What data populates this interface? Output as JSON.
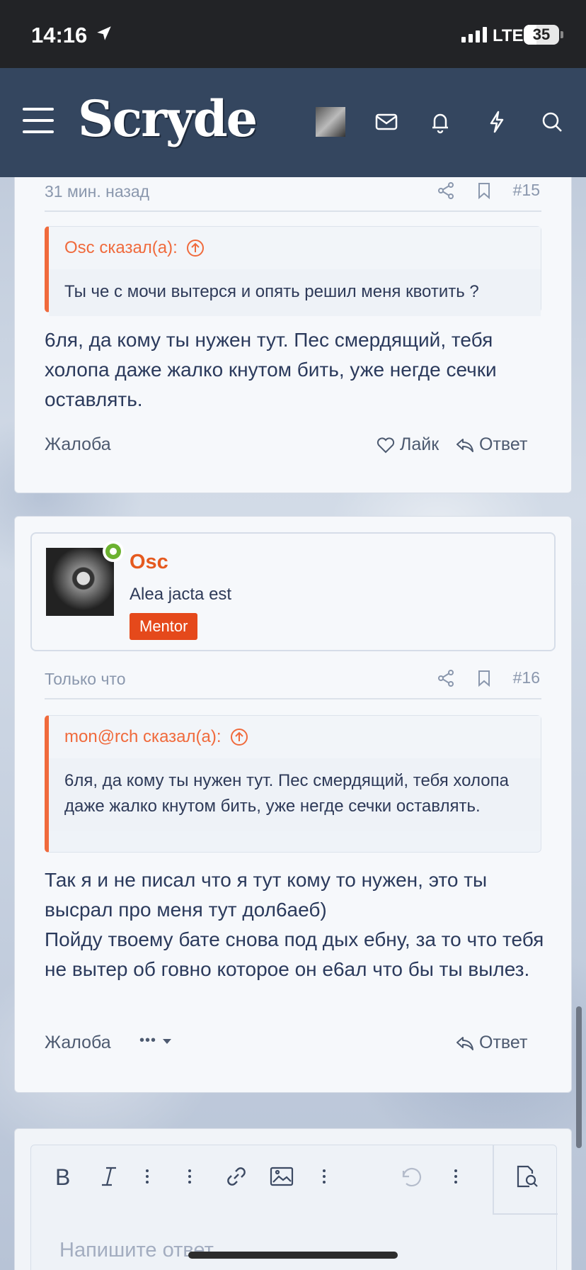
{
  "status_bar": {
    "time": "14:16",
    "network": "LTE",
    "battery": "35",
    "battery_fraction": 0.35
  },
  "header": {
    "logo": "Scryde",
    "icons": [
      "menu-icon",
      "avatar",
      "mail-icon",
      "bell-icon",
      "bolt-icon",
      "search-icon"
    ]
  },
  "posts": [
    {
      "time": "31 мин. назад",
      "number": "#15",
      "quote": {
        "author": "Osc сказал(а):",
        "text": "Ты че с мочи вытерся и опять решил меня квотить ?"
      },
      "text": "6ля, да кому ты нужен тут. Пес смердящий, тебя холопа даже жалко кнутом бить, уже негде сечки оставлять.",
      "actions": {
        "report": "Жалоба",
        "like": "Лайк",
        "reply": "Ответ"
      }
    },
    {
      "user": {
        "name": "Osc",
        "title": "Alea jacta est",
        "badge": "Mentor",
        "online": true
      },
      "time": "Только что",
      "number": "#16",
      "quote": {
        "author": "mon@rch сказал(а):",
        "text": "6ля, да кому ты нужен тут. Пес смердящий, тебя холопа даже жалко кнутом бить, уже негде сечки оставлять."
      },
      "text_lines": [
        "Так я и не писал что я тут кому то нужен, это ты высрал про меня тут дол6аеб)",
        "Пойду твоему бате снова под дых ебну, за то что тебя не вытер об говно которое он е6ал что бы ты вылез."
      ],
      "actions": {
        "report": "Жалоба",
        "more": "•••",
        "reply": "Ответ"
      }
    }
  ],
  "editor": {
    "placeholder": "Напишите ответ...",
    "toolbar": [
      "bold-icon",
      "italic-icon",
      "more-vertical-icon",
      "more-vertical-icon",
      "link-icon",
      "image-icon",
      "more-vertical-icon",
      "undo-icon",
      "more-vertical-icon",
      "preview-icon"
    ]
  },
  "colors": {
    "header_bg": "#34465f",
    "accent": "#f06a3c",
    "username": "#e55a1f",
    "badge": "#e5491b",
    "online": "#6cb230"
  }
}
